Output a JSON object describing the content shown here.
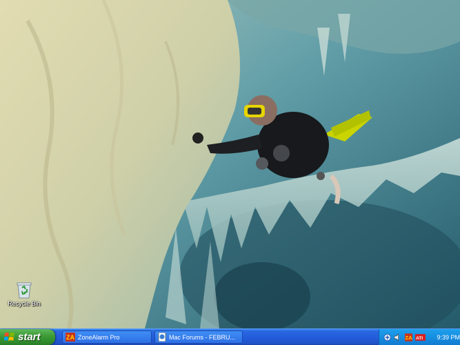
{
  "desktop": {
    "icons": [
      {
        "label": "Recycle Bin",
        "icon": "recycle-bin-icon"
      }
    ]
  },
  "taskbar": {
    "start_label": "start",
    "tasks": [
      {
        "label": "ZoneAlarm Pro",
        "icon": "zonealarm-icon"
      },
      {
        "label": "Mac Forums - FEBRU...",
        "icon": "browser-page-icon"
      }
    ],
    "tray": {
      "icons": [
        "network-icon",
        "speaker-icon",
        "zonealarm-tray-icon",
        "ati-icon"
      ],
      "clock": "9:39 PM"
    }
  }
}
